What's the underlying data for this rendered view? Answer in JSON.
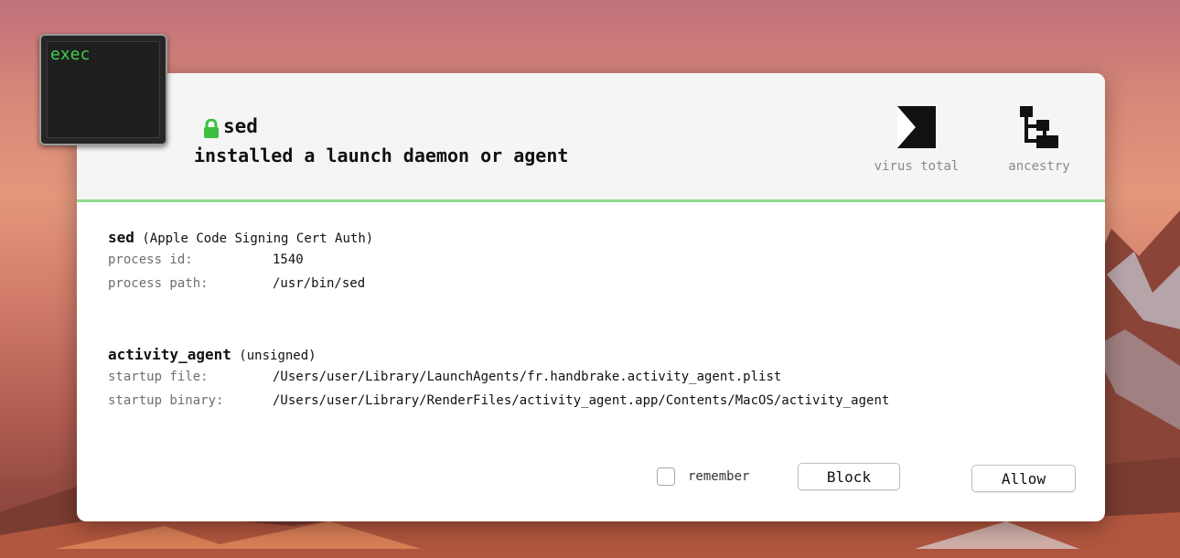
{
  "app_icon": {
    "label": "exec"
  },
  "header": {
    "process_name": "sed",
    "event": "installed a launch daemon or agent",
    "virus_total_label": "virus total",
    "ancestry_label": "ancestry"
  },
  "process": {
    "name": "sed",
    "signer": "(Apple Code Signing Cert Auth)",
    "pid_label": "process id:",
    "pid": "1540",
    "path_label": "process path:",
    "path": "/usr/bin/sed"
  },
  "item": {
    "name": "activity_agent",
    "signer": "(unsigned)",
    "file_label": "startup file:",
    "file": "/Users/user/Library/LaunchAgents/fr.handbrake.activity_agent.plist",
    "binary_label": "startup binary:",
    "binary": "/Users/user/Library/RenderFiles/activity_agent.app/Contents/MacOS/activity_agent"
  },
  "footer": {
    "remember_label": "remember",
    "remember_checked": false,
    "block_label": "Block",
    "allow_label": "Allow"
  },
  "colors": {
    "accent_green": "#8edb8c",
    "terminal_green": "#3fd04a",
    "lock_green": "#3cbf3f"
  },
  "icons": {
    "lock": "lock-icon",
    "virus_total": "virus-total-icon",
    "ancestry": "ancestry-tree-icon"
  }
}
